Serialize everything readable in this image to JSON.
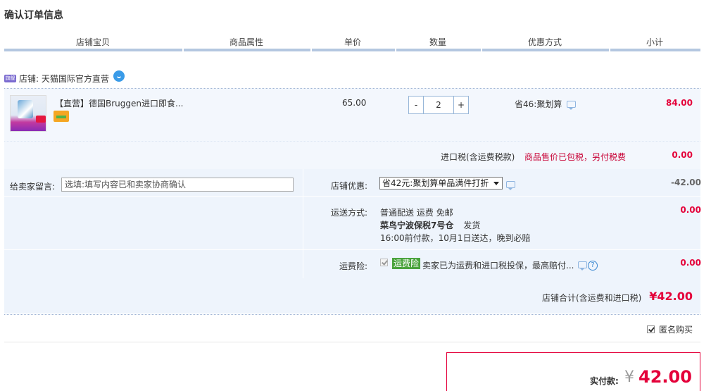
{
  "title": "确认订单信息",
  "columns": [
    "店铺宝贝",
    "商品属性",
    "单价",
    "数量",
    "优惠方式",
    "小计"
  ],
  "shop": {
    "icon_text": "旗舰",
    "label": "店铺: 天猫国际官方直营"
  },
  "item": {
    "title": "【直营】德国Bruggen进口即食...",
    "price": "65.00",
    "qty_minus": "-",
    "qty_value": "2",
    "qty_plus": "+",
    "discount": "省46:聚划算",
    "subtotal": "84.00"
  },
  "tax": {
    "label": "进口税(含运费税款)",
    "note": "商品售价已包税，另付税费",
    "value": "0.00"
  },
  "memo": {
    "label": "给卖家留言:",
    "placeholder": "选填:填写内容已和卖家协商确认"
  },
  "shop_discount": {
    "label": "店铺优惠:",
    "selected": "省42元:聚划算单品满件打折",
    "value": "-42.00"
  },
  "shipping": {
    "label": "运送方式:",
    "line1": "普通配送 运费 免邮",
    "warehouse": "菜鸟宁波保税7号仓",
    "dispatch": "发货",
    "line3": "16:00前付款，10月1日送达，晚到必赔",
    "value": "0.00"
  },
  "insurance": {
    "label": "运费险:",
    "badge": "运费险",
    "text": "卖家已为运费和进口税投保，最高赔付...",
    "help": "?",
    "value": "0.00"
  },
  "shop_total": {
    "label": "店铺合计(含运费和进口税)",
    "value": "¥42.00"
  },
  "anonymous": {
    "label": "匿名购买",
    "checked": true
  },
  "payment": {
    "label": "实付款:",
    "currency": "¥",
    "amount": "42.00"
  },
  "colors": {
    "accent_red": "#e4003a",
    "header_bar": "#b4c7e0",
    "row_bg": "#eef4fc"
  }
}
